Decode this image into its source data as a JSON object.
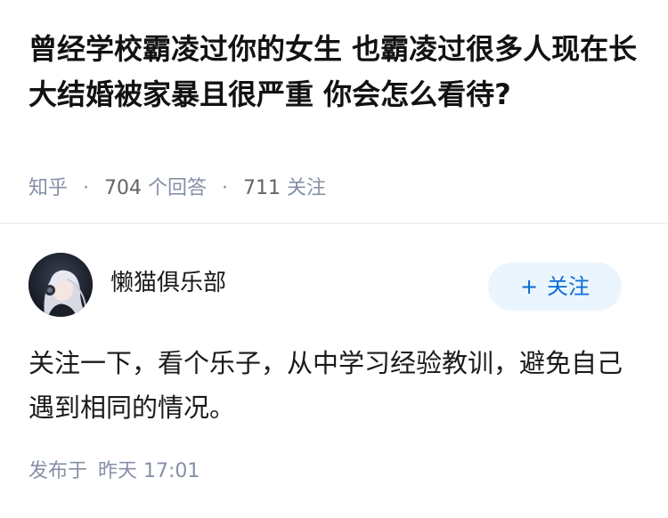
{
  "question": {
    "title": "曾经学校霸凌过你的女生 也霸凌过很多人现在长大结婚被家暴且很严重 你会怎么看待?",
    "source": "知乎",
    "answer_count": "704",
    "answer_label": "个回答",
    "follower_count": "711",
    "follower_label": "关注",
    "separator": "·"
  },
  "author": {
    "name": "懒猫俱乐部",
    "avatar_icon": "anime-girl-headphones-avatar",
    "follow_plus": "+",
    "follow_label": "关注"
  },
  "answer": {
    "text": "关注一下，看个乐子，从中学习经验教训，避免自己遇到相同的情况。",
    "published_label": "发布于",
    "published_time": "昨天 17:01"
  },
  "colors": {
    "title": "#121212",
    "meta": "#8590a6",
    "follow_bg": "#ebf5fd",
    "follow_text": "#0a6cd6",
    "divider": "#f2f2f4"
  }
}
